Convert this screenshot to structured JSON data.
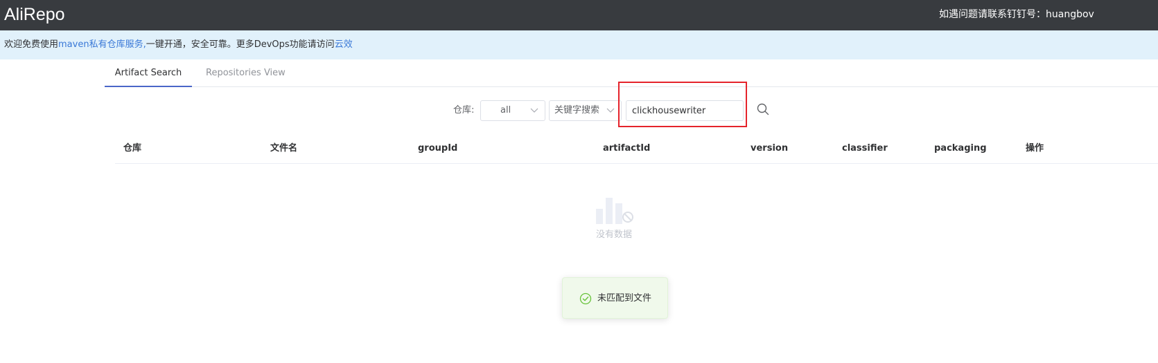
{
  "app": {
    "brand": "AliRepo",
    "contact": "如遇问题请联系钉钉号：huangbov"
  },
  "notice": {
    "prefix": "欢迎免费使用",
    "link_text": "maven私有仓库服务,",
    "middle": "一键开通，安全可靠。更多DevOps功能请访问",
    "link2_text": "云效"
  },
  "tabs": [
    {
      "label": "Artifact Search",
      "active": true
    },
    {
      "label": "Repositories View",
      "active": false
    }
  ],
  "filters": {
    "repo_label": "仓库:",
    "repo_value": "all",
    "mode_value": "关键字搜索",
    "search_value": "clickhousewriter"
  },
  "table": {
    "headers": [
      "仓库",
      "文件名",
      "groupId",
      "artifactId",
      "version",
      "classifier",
      "packaging",
      "操作"
    ],
    "empty_text": "没有数据"
  },
  "toast": {
    "text": "未匹配到文件"
  },
  "colors": {
    "topbar": "#383b3f",
    "notice_bg": "#e1f1fb",
    "link": "#3978d7",
    "tab_active": "#4a66c8",
    "highlight": "#e5232b",
    "success": "#67c23a"
  }
}
